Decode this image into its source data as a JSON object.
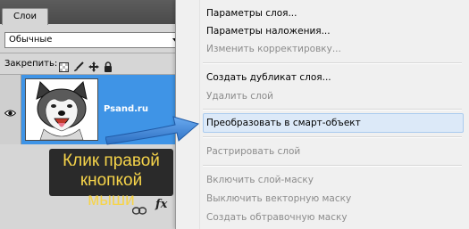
{
  "panel": {
    "tab_label": "Слои",
    "blend_mode": "Обычные",
    "lock_label": "Закрепить:",
    "layer_name": "Psand.ru",
    "footer_fx": "fx"
  },
  "callout": {
    "line1": "Клик правой",
    "line2": "кнопкой мыши"
  },
  "menu": {
    "items": [
      {
        "label": "Параметры слоя...",
        "enabled": true
      },
      {
        "label": "Параметры наложения...",
        "enabled": true
      },
      {
        "label": "Изменить корректировку...",
        "enabled": false
      },
      {
        "label": "Создать дубликат слоя...",
        "enabled": true
      },
      {
        "label": "Удалить слой",
        "enabled": false
      },
      {
        "label": "Преобразовать в смарт-объект",
        "enabled": true,
        "highlighted": true
      },
      {
        "label": "Растрировать слой",
        "enabled": false
      },
      {
        "label": "Включить слой-маску",
        "enabled": false
      },
      {
        "label": "Выключить векторную маску",
        "enabled": false
      },
      {
        "label": "Создать обтравочную маску",
        "enabled": false
      }
    ]
  },
  "colors": {
    "selected_layer": "#3f94e6",
    "callout_bg": "#2a2a2a",
    "callout_text": "#f6d44a",
    "arrow": "#3a7fd0"
  },
  "icons": [
    "eye-icon",
    "lock-transparent-icon",
    "brush-icon",
    "move-icon",
    "lock-icon",
    "link-icon",
    "fx-icon",
    "chevron-down-icon"
  ]
}
